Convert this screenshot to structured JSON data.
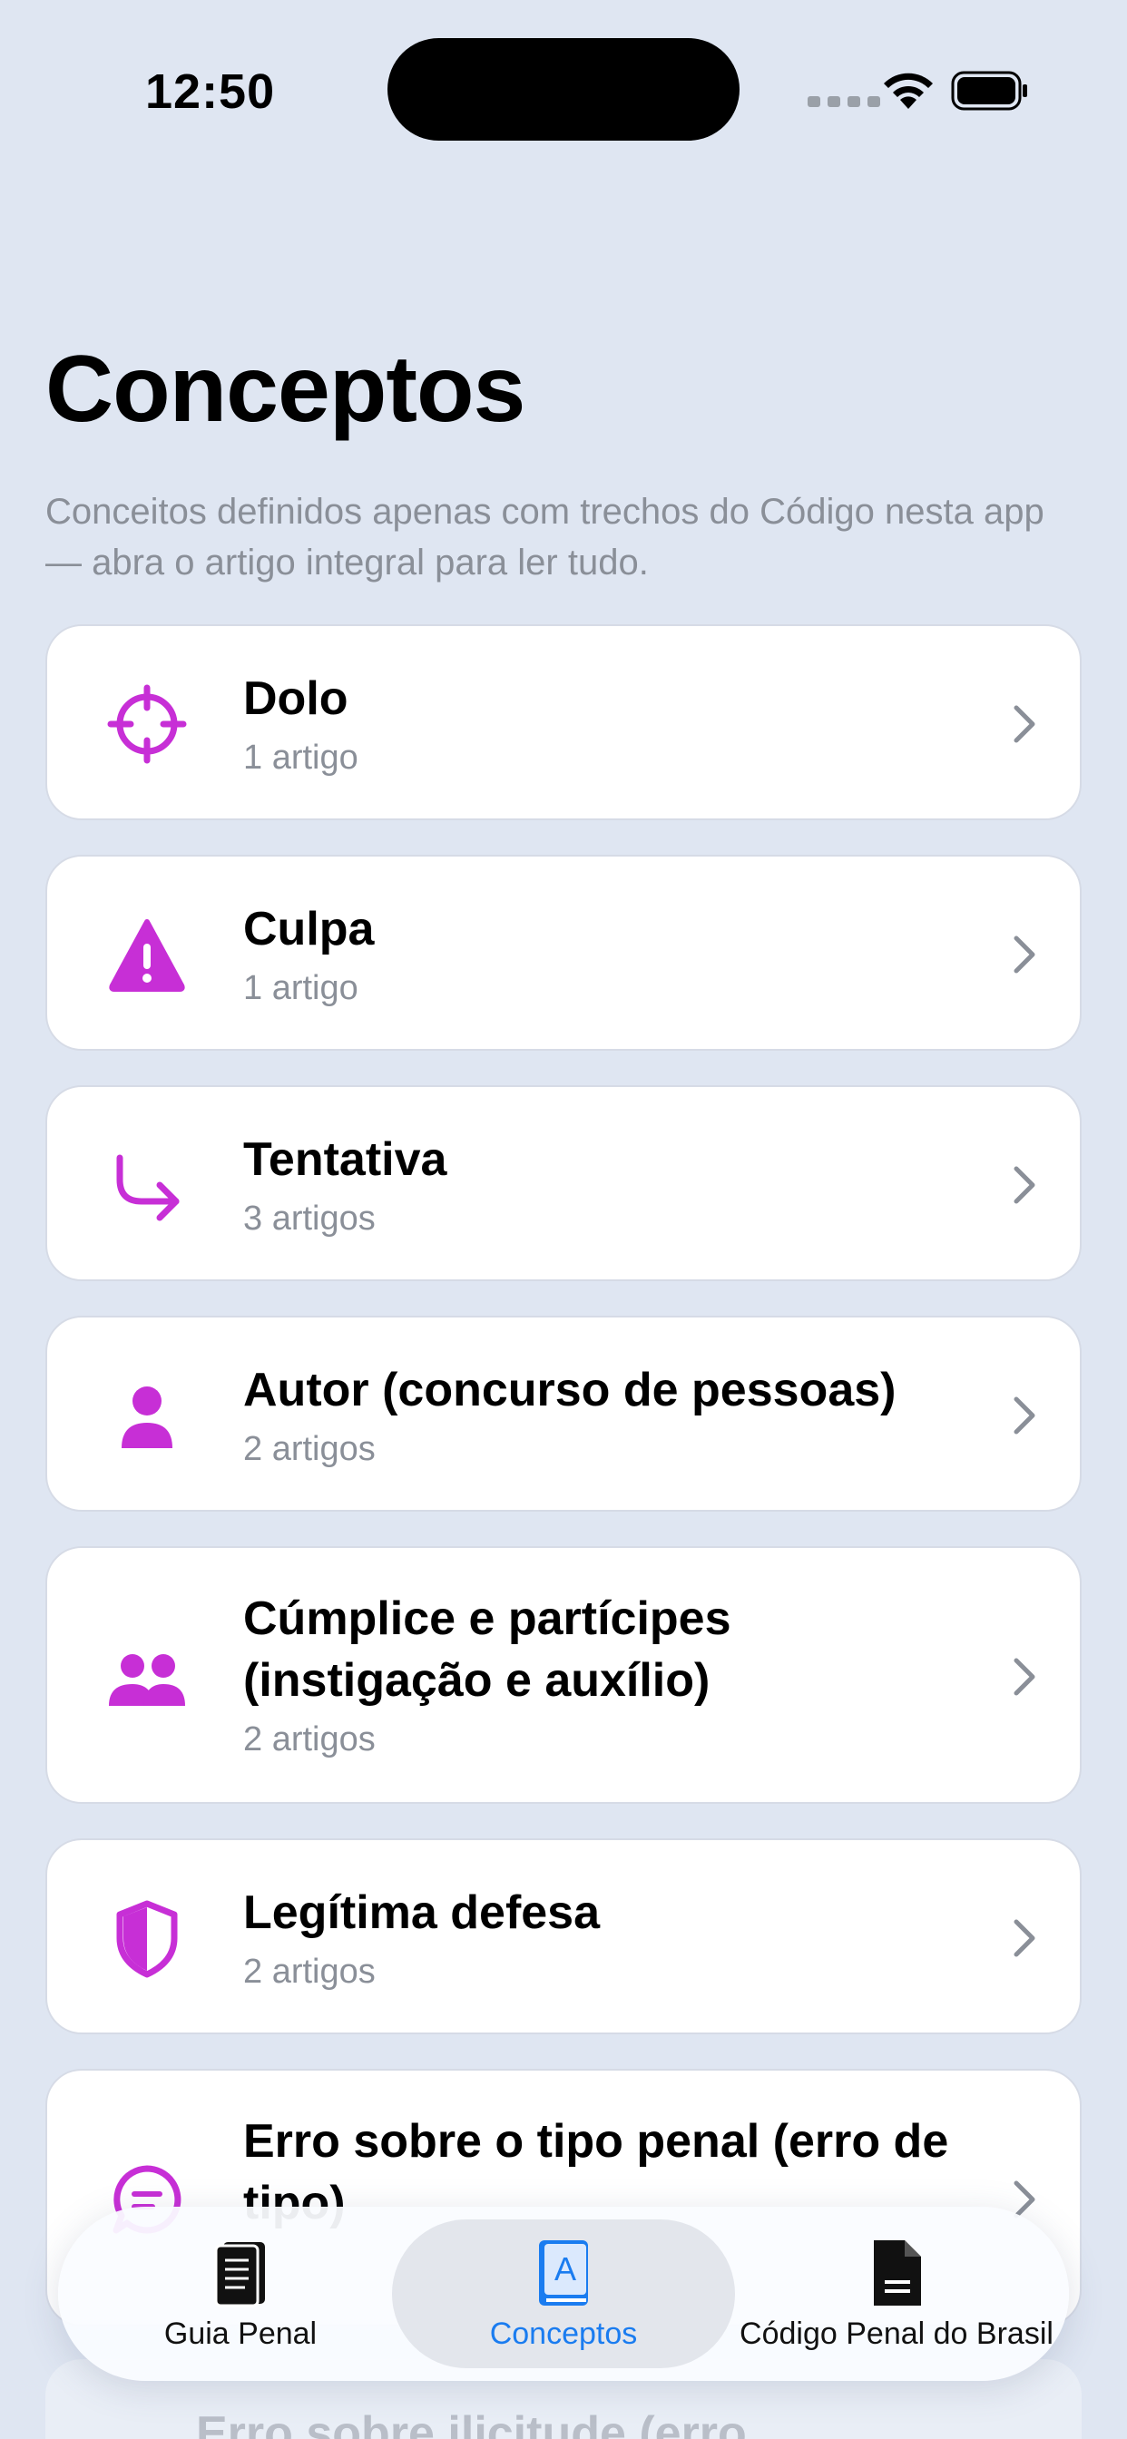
{
  "status": {
    "time": "12:50"
  },
  "header": {
    "title": "Conceptos",
    "subtitle": "Conceitos definidos apenas com trechos do Código nesta app — abra o artigo integral para ler tudo."
  },
  "accent_color": "#c72fd6",
  "concepts": [
    {
      "title": "Dolo",
      "count": "1 artigo",
      "icon": "scope-icon"
    },
    {
      "title": "Culpa",
      "count": "1 artigo",
      "icon": "warning-icon"
    },
    {
      "title": "Tentativa",
      "count": "3 artigos",
      "icon": "arrow-turn-icon"
    },
    {
      "title": "Autor (concurso de pessoas)",
      "count": "2 artigos",
      "icon": "person-icon"
    },
    {
      "title": "Cúmplice e partícipes (instigação e auxílio)",
      "count": "2 artigos",
      "icon": "people-icon"
    },
    {
      "title": "Legítima defesa",
      "count": "2 artigos",
      "icon": "shield-icon"
    },
    {
      "title": "Erro sobre o tipo penal (erro de tipo)",
      "count": "",
      "icon": "message-icon"
    },
    {
      "title": "Erro sobre ilicitude (erro"
    }
  ],
  "tabs": [
    {
      "label": "Guia Penal",
      "icon": "book-icon",
      "selected": false
    },
    {
      "label": "Conceptos",
      "icon": "dictionary-icon",
      "selected": true
    },
    {
      "label": "Código Penal do Brasil",
      "icon": "document-icon",
      "selected": false
    }
  ]
}
